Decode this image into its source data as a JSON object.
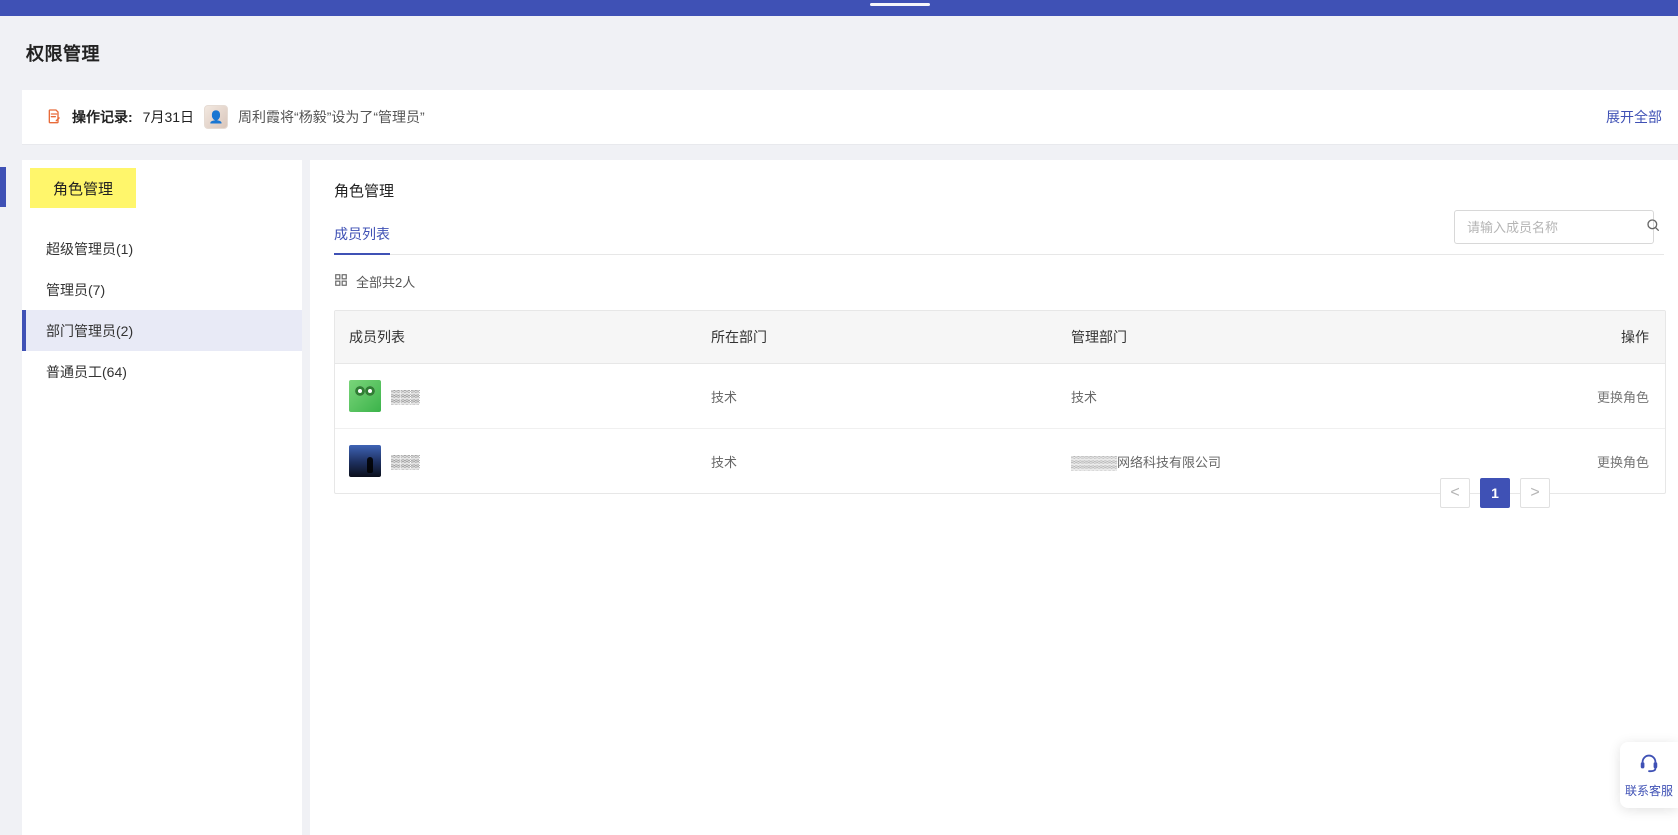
{
  "page": {
    "title": "权限管理"
  },
  "log": {
    "label": "操作记录:",
    "date": "7月31日",
    "text": "周利霞将“杨毅”设为了“管理员”",
    "expand": "展开全部"
  },
  "sidebar": {
    "title": "角色管理",
    "items": [
      {
        "label": "超级管理员(1)"
      },
      {
        "label": "管理员(7)"
      },
      {
        "label": "部门管理员(2)"
      },
      {
        "label": "普通员工(64)"
      }
    ]
  },
  "main": {
    "title": "角色管理",
    "tab": "成员列表",
    "search": {
      "placeholder": "请输入成员名称"
    },
    "count": "全部共2人",
    "table": {
      "headers": {
        "member": "成员列表",
        "dept": "所在部门",
        "managed": "管理部门",
        "actions": "操作"
      },
      "rows": [
        {
          "name": "▒▒▒",
          "dept": "技术",
          "managed": "技术",
          "action": "更换角色"
        },
        {
          "name": "▒▒▒",
          "dept": "技术",
          "managed": "▒▒▒▒▒网络科技有限公司",
          "action": "更换角色"
        }
      ]
    },
    "pagination": {
      "prev": "<",
      "page": "1",
      "next": ">"
    }
  },
  "support": {
    "label": "联系客服"
  },
  "colors": {
    "brand": "#3f51b5",
    "highlight": "#fff66b",
    "selected_bg": "#e8eaf6"
  },
  "icons": {
    "log": "edit-note-icon",
    "search": "search-icon",
    "count": "grid-icon",
    "support": "headset-icon"
  }
}
